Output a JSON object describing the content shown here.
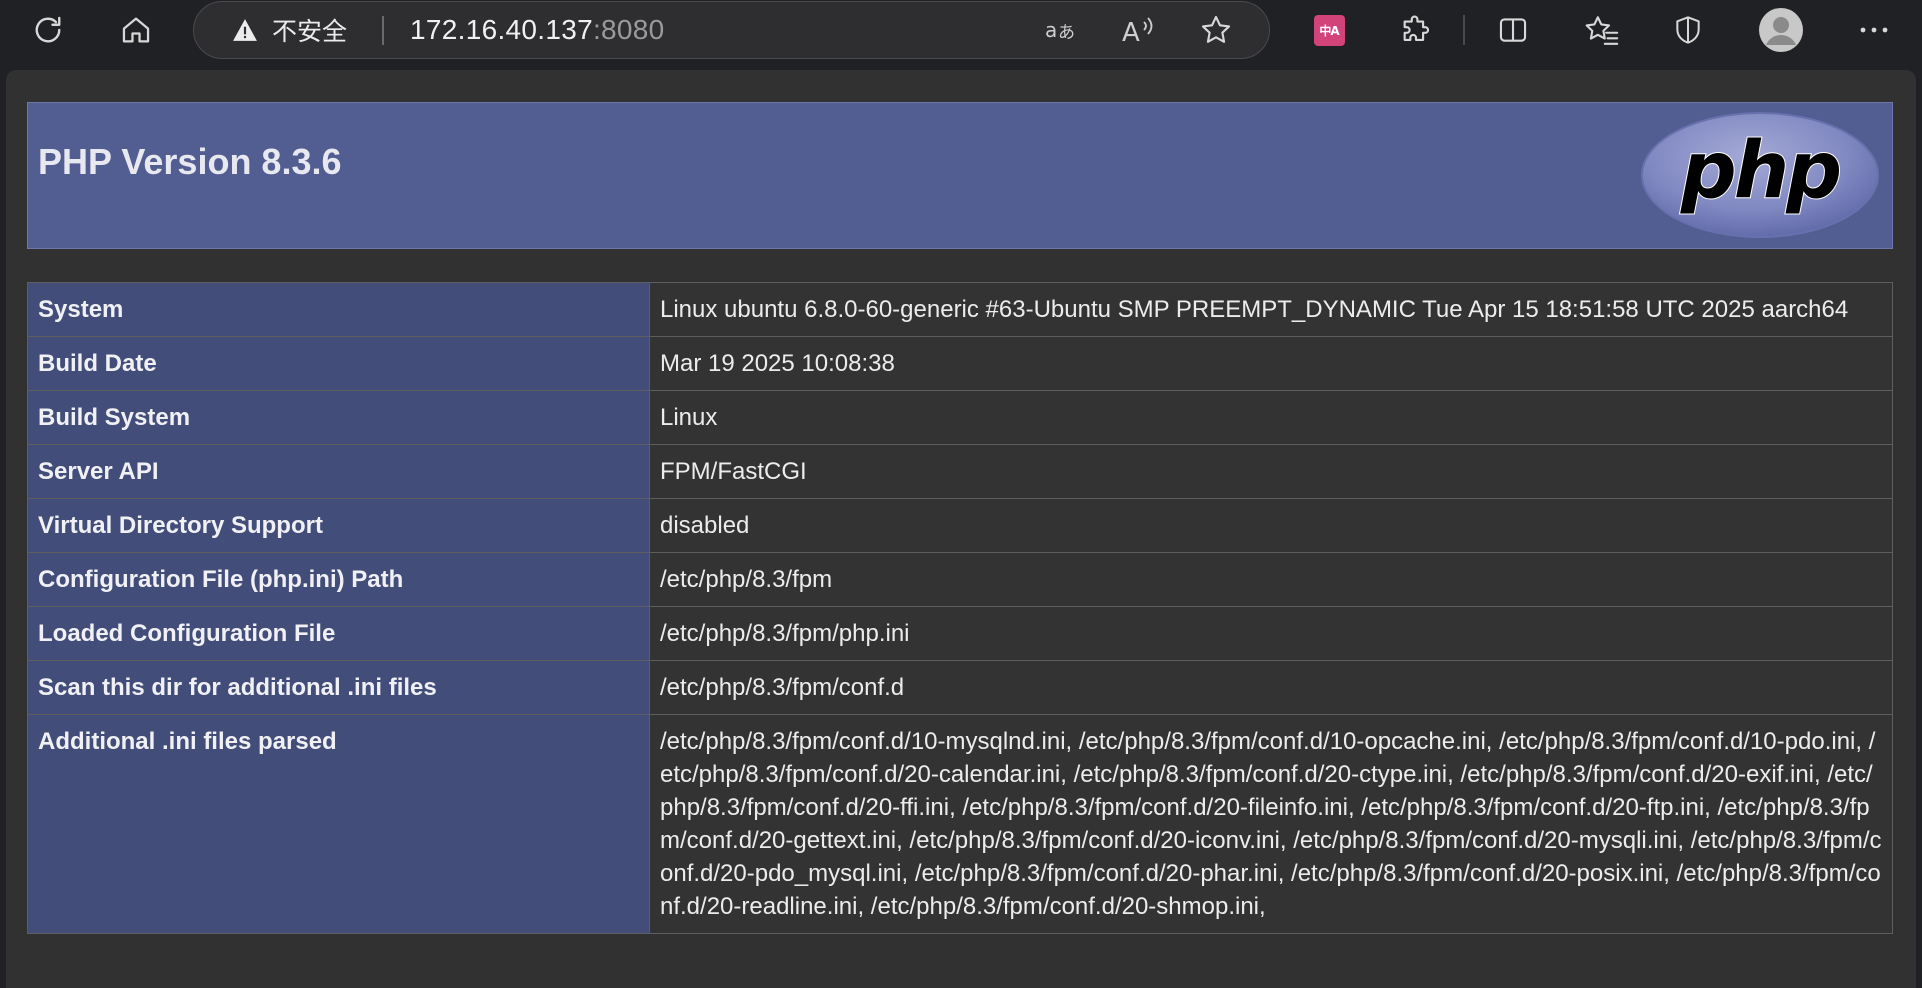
{
  "toolbar": {
    "icons": [
      "refresh-icon",
      "home-icon",
      "translate-icon",
      "read-aloud-icon",
      "favorite-star-icon",
      "translator-extension-icon",
      "extensions-icon",
      "split-screen-icon",
      "favorites-icon",
      "browser-essentials-icon",
      "profile-avatar-icon",
      "more-icon"
    ],
    "security_label": "不安全",
    "url_host": "172.16.40.137",
    "url_port": ":8080",
    "translate_extension_badge": "中A"
  },
  "page": {
    "title": "PHP Version 8.3.6",
    "logo_text": "php",
    "rows": [
      {
        "key": "System",
        "value": "Linux ubuntu 6.8.0-60-generic #63-Ubuntu SMP PREEMPT_DYNAMIC Tue Apr 15 18:51:58 UTC 2025 aarch64"
      },
      {
        "key": "Build Date",
        "value": "Mar 19 2025 10:08:38"
      },
      {
        "key": "Build System",
        "value": "Linux"
      },
      {
        "key": "Server API",
        "value": "FPM/FastCGI"
      },
      {
        "key": "Virtual Directory Support",
        "value": "disabled"
      },
      {
        "key": "Configuration File (php.ini) Path",
        "value": "/etc/php/8.3/fpm"
      },
      {
        "key": "Loaded Configuration File",
        "value": "/etc/php/8.3/fpm/php.ini"
      },
      {
        "key": "Scan this dir for additional .ini files",
        "value": "/etc/php/8.3/fpm/conf.d"
      },
      {
        "key": "Additional .ini files parsed",
        "value": "/etc/php/8.3/fpm/conf.d/10-mysqlnd.ini, /etc/php/8.3/fpm/conf.d/10-opcache.ini, /etc/php/8.3/fpm/conf.d/10-pdo.ini, /etc/php/8.3/fpm/conf.d/20-calendar.ini, /etc/php/8.3/fpm/conf.d/20-ctype.ini, /etc/php/8.3/fpm/conf.d/20-exif.ini, /etc/php/8.3/fpm/conf.d/20-ffi.ini, /etc/php/8.3/fpm/conf.d/20-fileinfo.ini, /etc/php/8.3/fpm/conf.d/20-ftp.ini, /etc/php/8.3/fpm/conf.d/20-gettext.ini, /etc/php/8.3/fpm/conf.d/20-iconv.ini, /etc/php/8.3/fpm/conf.d/20-mysqli.ini, /etc/php/8.3/fpm/conf.d/20-pdo_mysql.ini, /etc/php/8.3/fpm/conf.d/20-phar.ini, /etc/php/8.3/fpm/conf.d/20-posix.ini, /etc/php/8.3/fpm/conf.d/20-readline.ini, /etc/php/8.3/fpm/conf.d/20-shmop.ini,"
      }
    ]
  },
  "colors": {
    "header_bg": "#525d91",
    "key_cell_bg": "#434d79",
    "value_cell_bg": "#333333",
    "browser_chrome": "#202124"
  }
}
